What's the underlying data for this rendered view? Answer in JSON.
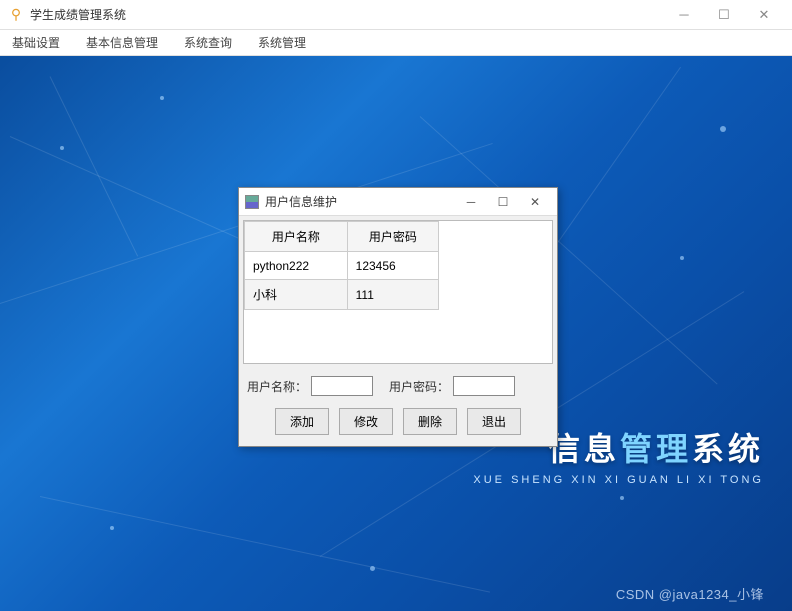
{
  "main_window": {
    "title": "学生成绩管理系统",
    "menu": [
      "基础设置",
      "基本信息管理",
      "系统查询",
      "系统管理"
    ]
  },
  "brand": {
    "pre": "信息",
    "mid": "管理",
    "post": "系统",
    "pinyin": "XUE SHENG XIN XI GUAN LI XI TONG"
  },
  "watermark": "CSDN @java1234_小锋",
  "dialog": {
    "title": "用户信息维护",
    "columns": [
      "用户名称",
      "用户密码"
    ],
    "rows": [
      {
        "name": "python222",
        "pwd": "123456"
      },
      {
        "name": "小科",
        "pwd": "111"
      }
    ],
    "form": {
      "label_name": "用户名称：",
      "label_pwd": "用户密码：",
      "value_name": "",
      "value_pwd": ""
    },
    "buttons": {
      "add": "添加",
      "edit": "修改",
      "delete": "删除",
      "exit": "退出"
    }
  }
}
